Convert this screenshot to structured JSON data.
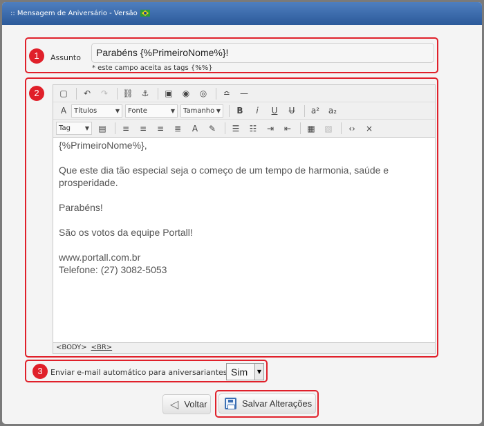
{
  "window": {
    "title": ":: Mensagem de Aniversário - Versão",
    "flag_icon": "brazil-flag-icon"
  },
  "badges": [
    "1",
    "2",
    "3"
  ],
  "subject": {
    "label": "Assunto",
    "value": "Parabéns {%PrimeiroNome%}!",
    "hint": "* este campo aceita as tags {%%}"
  },
  "editor": {
    "toolbar": {
      "styles_combo": "Títulos",
      "font_combo": "Fonte",
      "size_combo": "Tamanho",
      "tag_combo": "Tag"
    },
    "content": {
      "greeting": "{%PrimeiroNome%},",
      "message": "Que este dia tão especial seja o começo de um tempo de harmonia, saúde e prosperidade.",
      "congrats": "Parabéns!",
      "wishes": "São os votos da equipe Portall!",
      "website": "www.portall.com.br",
      "phone": "Telefone: (27) 3082-5053"
    },
    "status_tags": [
      "<BODY>",
      "<BR>"
    ]
  },
  "auto_email": {
    "label": "Enviar e-mail automático para aniversariantes:",
    "value": "Sim"
  },
  "buttons": {
    "back": "Voltar",
    "save": "Salvar Alterações"
  },
  "colors": {
    "highlight": "#e0202a",
    "titlebar": "#2c5a9a"
  }
}
